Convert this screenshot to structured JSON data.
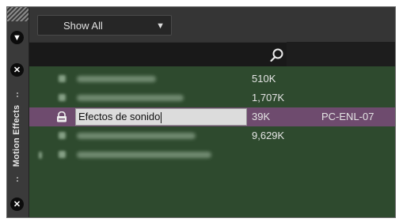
{
  "panel": {
    "vertical_label": "Motion Effects",
    "filter": {
      "selected": "Show All"
    }
  },
  "list": {
    "rows": [
      {
        "name": "",
        "size": "510K",
        "code": "",
        "blurred": true
      },
      {
        "name": "",
        "size": "1,707K",
        "code": "",
        "blurred": true
      },
      {
        "name": "Efectos de sonido",
        "size": "39K",
        "code": "PC-ENL-07",
        "blurred": false,
        "selected": true,
        "editing": true
      },
      {
        "name": "",
        "size": "9,629K",
        "code": "",
        "blurred": true
      },
      {
        "name": "",
        "size": "",
        "code": "",
        "blurred": true
      }
    ]
  },
  "colors": {
    "list_bg": "#2e4a2e",
    "selected_row": "#6e4b6e",
    "panel_bg": "#232323"
  }
}
